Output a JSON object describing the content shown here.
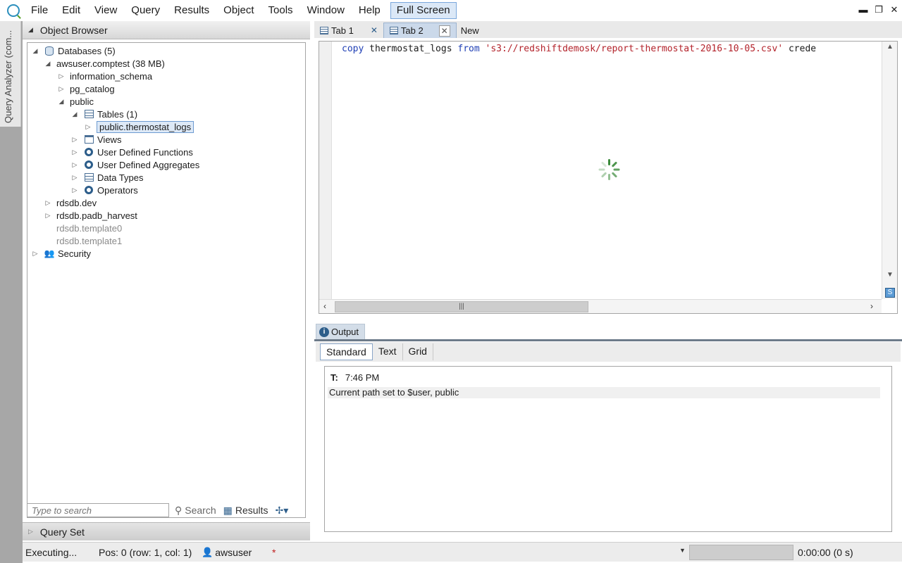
{
  "menu": {
    "items": [
      "File",
      "Edit",
      "View",
      "Query",
      "Results",
      "Object",
      "Tools",
      "Window",
      "Help"
    ],
    "fullscreen_label": "Full Screen"
  },
  "side_strip": {
    "label": "Query Analyzer (com..."
  },
  "object_browser": {
    "title": "Object Browser",
    "tree": {
      "databases": "Databases (5)",
      "db_main": "awsuser.comptest (38 MB)",
      "schema_info": "information_schema",
      "schema_pg": "pg_catalog",
      "schema_public": "public",
      "tables": "Tables (1)",
      "table_selected": "public.thermostat_logs",
      "views": "Views",
      "udf": "User Defined Functions",
      "uda": "User Defined Aggregates",
      "data_types": "Data Types",
      "operators": "Operators",
      "db_dev": "rdsdb.dev",
      "db_harvest": "rdsdb.padb_harvest",
      "db_template0": "rdsdb.template0",
      "db_template1": "rdsdb.template1",
      "security": "Security"
    },
    "search_placeholder": "Type to search",
    "search_label": "Search",
    "results_label": "Results"
  },
  "query_set": {
    "title": "Query Set"
  },
  "tabs": [
    {
      "label": "Tab 1"
    },
    {
      "label": "Tab 2"
    },
    {
      "label": "New"
    }
  ],
  "editor": {
    "kw_copy": "copy",
    "ident": " thermostat_logs ",
    "kw_from": "from",
    "string": " 's3://redshiftdemosk/report-thermostat-2016-10-05.csv'",
    "trail": " crede"
  },
  "output": {
    "title": "Output",
    "subtabs": [
      "Standard",
      "Text",
      "Grid"
    ],
    "time_label": "T:",
    "time": "7:46 PM",
    "message": "Current path set to $user, public"
  },
  "status": {
    "state": "Executing...",
    "position": "Pos: 0 (row: 1, col: 1)",
    "user": "awsuser",
    "modified": "*",
    "elapsed": "0:00:00 (0 s)"
  }
}
